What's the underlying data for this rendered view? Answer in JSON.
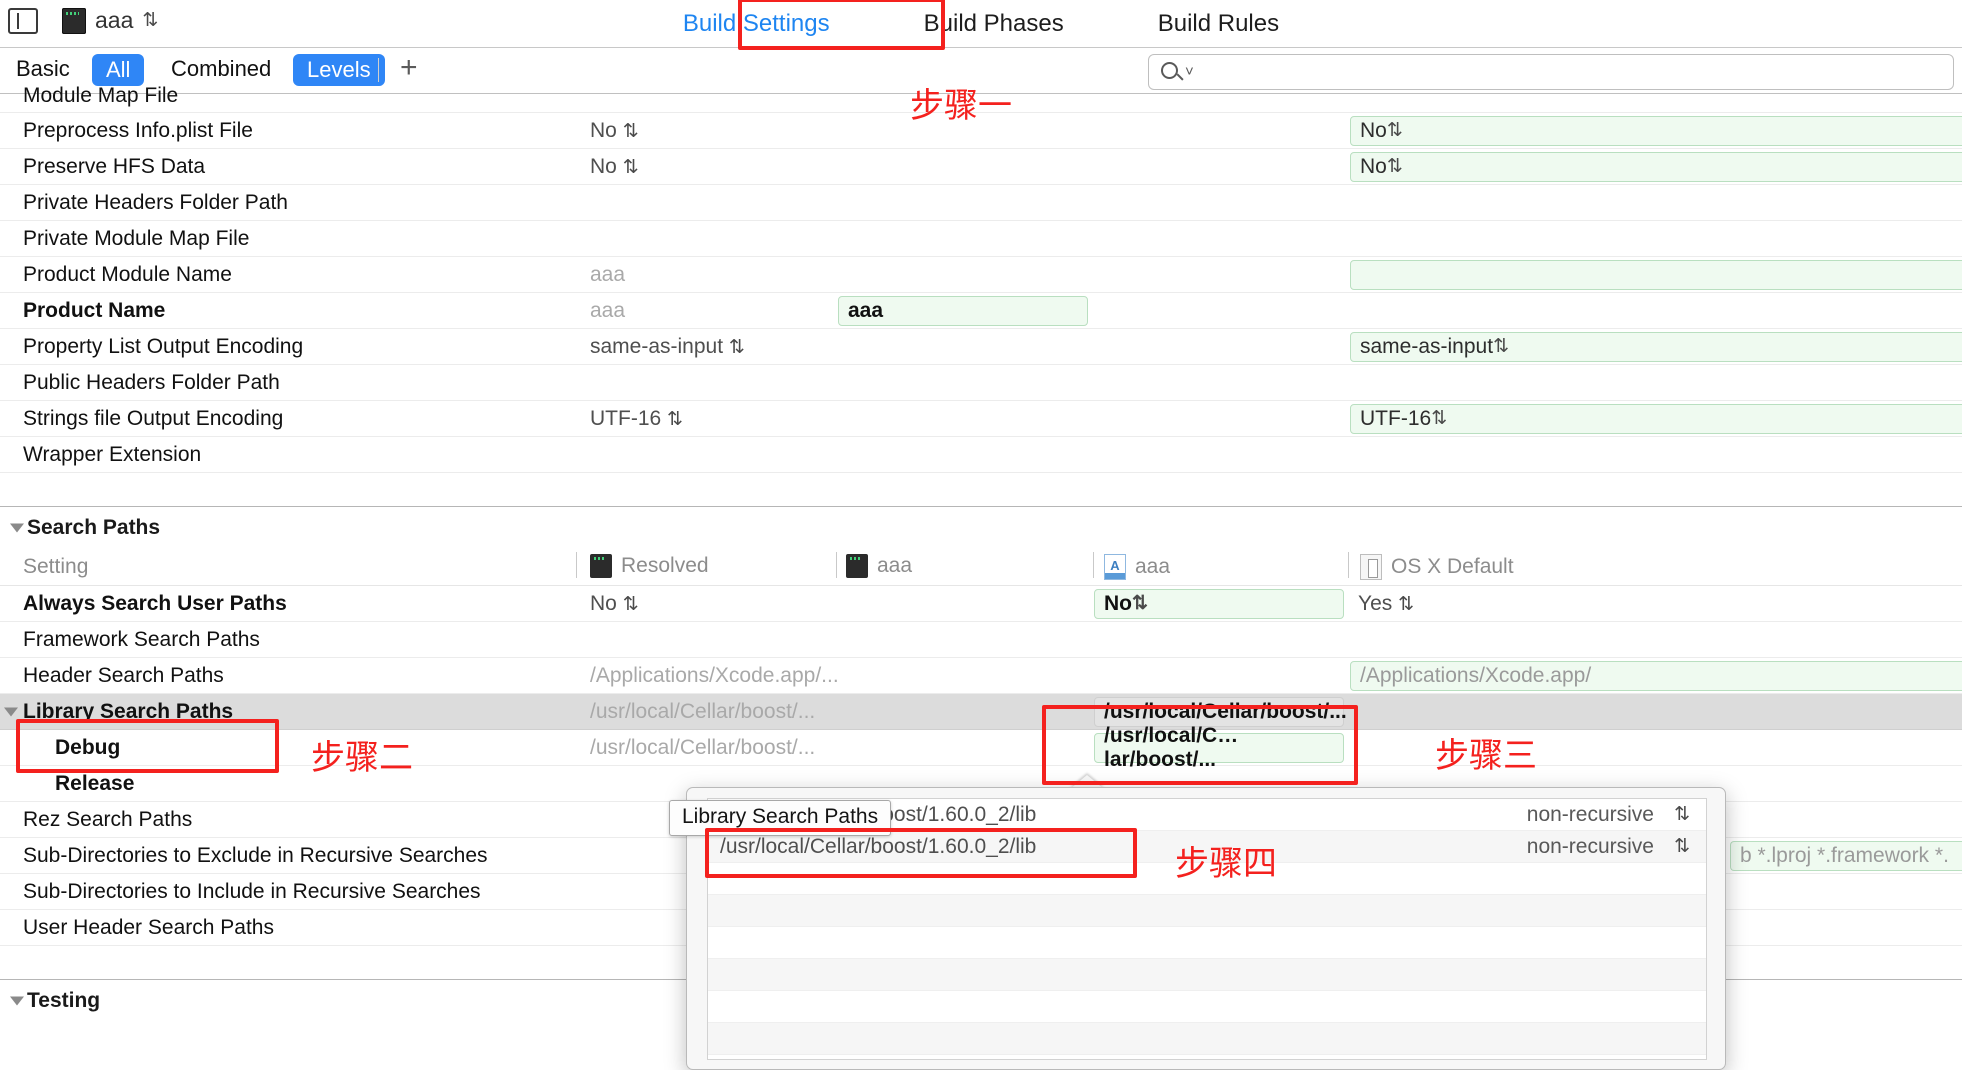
{
  "titlebar": {
    "sidebar_toggle": "toggle-navigator",
    "scheme_name": "aaa",
    "stepper_glyph": "⇅"
  },
  "tabs": [
    {
      "label": "Build Settings",
      "active": true
    },
    {
      "label": "Build Phases",
      "active": false
    },
    {
      "label": "Build Rules",
      "active": false
    }
  ],
  "filterbar": {
    "basic": "Basic",
    "all": "All",
    "combined": "Combined",
    "levels": "Levels",
    "add": "+",
    "search_placeholder": ""
  },
  "column_headers": [
    {
      "label": "Resolved",
      "icon": "app-target-icon"
    },
    {
      "label": "aaa",
      "icon": "app-target-icon"
    },
    {
      "label": "aaa",
      "icon": "project-file-icon"
    },
    {
      "label": "OS X Default",
      "icon": "os-default-icon"
    }
  ],
  "setting_col_label": "Setting",
  "groups": [
    {
      "name": "Search Paths",
      "expanded": true
    },
    {
      "name": "Testing",
      "expanded": true
    }
  ],
  "rows_top": [
    {
      "name": "Module Map File",
      "bold": false,
      "resolved": "",
      "config": "",
      "project": "",
      "osx": "",
      "osx_field": false,
      "clipped": true
    },
    {
      "name": "Preprocess Info.plist File",
      "bold": false,
      "resolved": "No",
      "resolved_stepper": true,
      "config": "",
      "project": "",
      "osx": "No",
      "osx_stepper": true,
      "osx_field": true
    },
    {
      "name": "Preserve HFS Data",
      "bold": false,
      "resolved": "No",
      "resolved_stepper": true,
      "config": "",
      "project": "",
      "osx": "No",
      "osx_stepper": true,
      "osx_field": true
    },
    {
      "name": "Private Headers Folder Path",
      "bold": false,
      "resolved": "",
      "config": "",
      "project": "",
      "osx": "",
      "osx_field": false
    },
    {
      "name": "Private Module Map File",
      "bold": false,
      "resolved": "",
      "config": "",
      "project": "",
      "osx": "",
      "osx_field": false
    },
    {
      "name": "Product Module Name",
      "bold": false,
      "resolved": "aaa",
      "resolved_ghost": true,
      "config": "",
      "project": "",
      "osx": "",
      "osx_field": true
    },
    {
      "name": "Product Name",
      "bold": true,
      "resolved": "aaa",
      "resolved_ghost": true,
      "config": "aaa",
      "config_field": true,
      "project": "",
      "osx": "",
      "osx_field": false
    },
    {
      "name": "Property List Output Encoding",
      "bold": false,
      "resolved": "same-as-input",
      "resolved_stepper": true,
      "config": "",
      "project": "",
      "osx": "same-as-input",
      "osx_stepper": true,
      "osx_field": true
    },
    {
      "name": "Public Headers Folder Path",
      "bold": false,
      "resolved": "",
      "config": "",
      "project": "",
      "osx": "",
      "osx_field": false
    },
    {
      "name": "Strings file Output Encoding",
      "bold": false,
      "resolved": "UTF-16",
      "resolved_stepper": true,
      "config": "",
      "project": "",
      "osx": "UTF-16",
      "osx_stepper": true,
      "osx_field": true
    },
    {
      "name": "Wrapper Extension",
      "bold": false,
      "resolved": "",
      "config": "",
      "project": "",
      "osx": "",
      "osx_field": false
    }
  ],
  "rows_search_paths": [
    {
      "name": "Always Search User Paths",
      "bold": true,
      "indent": false,
      "resolved": "No",
      "resolved_stepper": true,
      "project": "No",
      "project_field": true,
      "project_bold": true,
      "project_stepper": true,
      "osx": "Yes",
      "osx_stepper": true
    },
    {
      "name": "Framework Search Paths",
      "bold": false,
      "indent": false,
      "resolved": "",
      "project": "",
      "osx": ""
    },
    {
      "name": "Header Search Paths",
      "bold": false,
      "indent": false,
      "resolved": "/Applications/Xcode.app/...",
      "resolved_ghost": true,
      "project": "",
      "osx": "/Applications/Xcode.app/",
      "osx_field": true
    },
    {
      "name": "Library Search Paths",
      "bold": true,
      "indent": false,
      "selected": true,
      "expanded": true,
      "resolved": "/usr/local/Cellar/boost/...",
      "resolved_ghost": true,
      "project": "/usr/local/Cellar/boost/...",
      "project_bold": true,
      "osx": ""
    },
    {
      "name": "Debug",
      "bold": true,
      "indent": true,
      "resolved": "/usr/local/Cellar/boost/...",
      "resolved_ghost": true,
      "project": "/usr/local/C…lar/boost/...",
      "project_bold": true,
      "osx": ""
    },
    {
      "name": "Release",
      "bold": true,
      "indent": true,
      "resolved": "",
      "project": "",
      "osx": ""
    },
    {
      "name": "Rez Search Paths",
      "bold": false,
      "indent": false,
      "resolved": "",
      "project": "",
      "osx": ""
    },
    {
      "name": "Sub-Directories to Exclude in Recursive Searches",
      "bold": false,
      "indent": false,
      "resolved": "",
      "project": "",
      "osx": "b *.lproj *.framework *."
    },
    {
      "name": "Sub-Directories to Include in Recursive Searches",
      "bold": false,
      "indent": false,
      "resolved": "",
      "project": "",
      "osx": ""
    },
    {
      "name": "User Header Search Paths",
      "bold": false,
      "indent": false,
      "resolved": "",
      "project": "",
      "osx": ""
    }
  ],
  "popover": {
    "title_tooltip": "Library Search Paths",
    "rows": [
      {
        "path": "/usr/local/Cellar/boost/1.60.0_2/lib",
        "recursion": "non-recursive",
        "hidden_behind_tooltip": true
      },
      {
        "path": "/usr/local/Cellar/boost/1.60.0_2/lib",
        "recursion": "non-recursive",
        "highlighted": true
      }
    ],
    "stepper_glyph": "⇅"
  },
  "annotations": [
    {
      "id": "step-1",
      "label": "步骤一",
      "target": "build-settings-tab"
    },
    {
      "id": "step-2",
      "label": "步骤二",
      "target": "library-search-paths-row-name"
    },
    {
      "id": "step-3",
      "label": "步骤三",
      "target": "library-search-paths-project-value"
    },
    {
      "id": "step-4",
      "label": "步骤四",
      "target": "popover-path-row"
    }
  ],
  "colors": {
    "accent_blue": "#2f86f6",
    "annotation_red": "#f4211e",
    "green_field_bg": "#effaf0",
    "green_field_border": "#b9dfc0",
    "selected_row": "#dcdcdc"
  }
}
